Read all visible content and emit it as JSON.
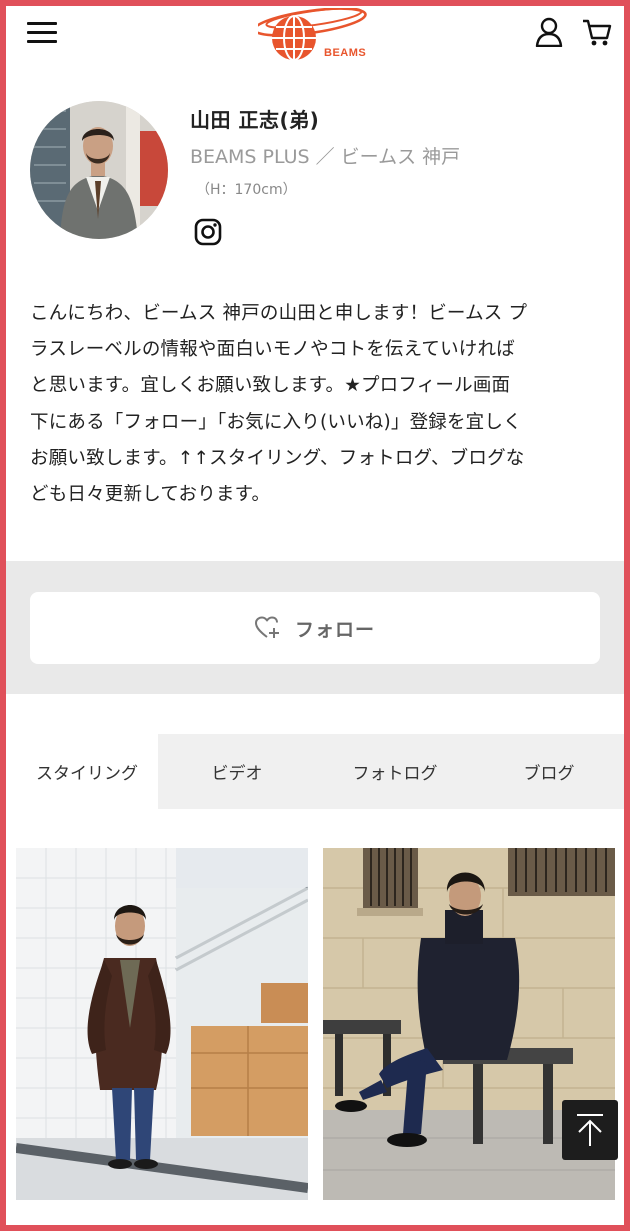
{
  "header": {
    "logo_text": "BEAMS",
    "menu_icon": "hamburger-menu-icon",
    "user_icon": "user-icon",
    "cart_icon": "cart-icon"
  },
  "profile": {
    "name": "山田 正志(弟)",
    "shop": "BEAMS PLUS ／ ビームス 神戸",
    "height": "（H：170cm）",
    "social_icon": "instagram-icon"
  },
  "bio": {
    "lines": [
      "こんにちわ、ビームス 神戸の山田と申します！ビームス プ",
      "ラスレーベルの情報や面白いモノやコトを伝えていければ",
      "と思います。宜しくお願い致します。★プロフィール画面",
      "下にある「フォロー」「お気に入り(いいね)」登録を宜しく",
      "お願い致します。↑↑スタイリング、フォトログ、ブログな",
      "ども日々更新しております。"
    ]
  },
  "follow": {
    "label": "フォロー",
    "icon": "heart-plus-icon"
  },
  "tabs": [
    {
      "label": "スタイリング",
      "active": true
    },
    {
      "label": "ビデオ",
      "active": false
    },
    {
      "label": "フォトログ",
      "active": false
    },
    {
      "label": "ブログ",
      "active": false
    }
  ],
  "gallery": {
    "items": [
      {
        "description_icon": "styling-photo-1"
      },
      {
        "description_icon": "styling-photo-2"
      }
    ]
  },
  "back_to_top": {
    "icon": "arrow-up-icon"
  },
  "colors": {
    "frame": "#e0505a",
    "logo": "#e8552d",
    "follow_band": "#e9e9e9",
    "tab_bg": "#f0f0f0"
  }
}
